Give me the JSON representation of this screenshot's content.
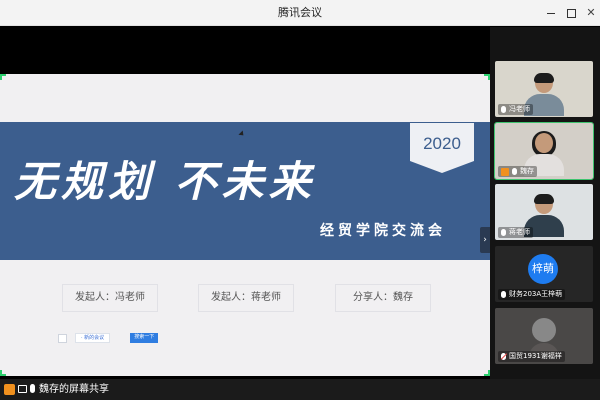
{
  "window": {
    "title": "腾讯会议"
  },
  "slide": {
    "heading": "无规划 不未来",
    "year": "2020",
    "subtitle": "经贸学院交流会",
    "presenters": [
      "发起人：冯老师",
      "发起人：蒋老师",
      "分享人：魏存"
    ],
    "toolbar_link": "· 新的会议",
    "toolbar_button": "搜索一下"
  },
  "participants": [
    {
      "name": "冯老师",
      "mic": "on",
      "type": "video"
    },
    {
      "name": "魏存",
      "mic": "on",
      "type": "video",
      "active": true
    },
    {
      "name": "蒋老师",
      "mic": "on",
      "type": "video"
    },
    {
      "name": "财务203A王梓萌",
      "mic": "on",
      "type": "avatar",
      "avatar_text": "梓萌"
    },
    {
      "name": "国贸1931谢福祥",
      "mic": "muted",
      "type": "video"
    }
  ],
  "status": {
    "text": "魏存的屏幕共享"
  },
  "colors": {
    "band": "#3c5e8e",
    "corner_accent": "#2ccf6e",
    "avatar_blue": "#1e7cf0"
  },
  "icons": [
    "minimize-icon",
    "maximize-icon",
    "close-icon",
    "mic-icon",
    "mic-muted-icon",
    "user-icon",
    "screen-share-icon",
    "chevron-right-icon"
  ]
}
